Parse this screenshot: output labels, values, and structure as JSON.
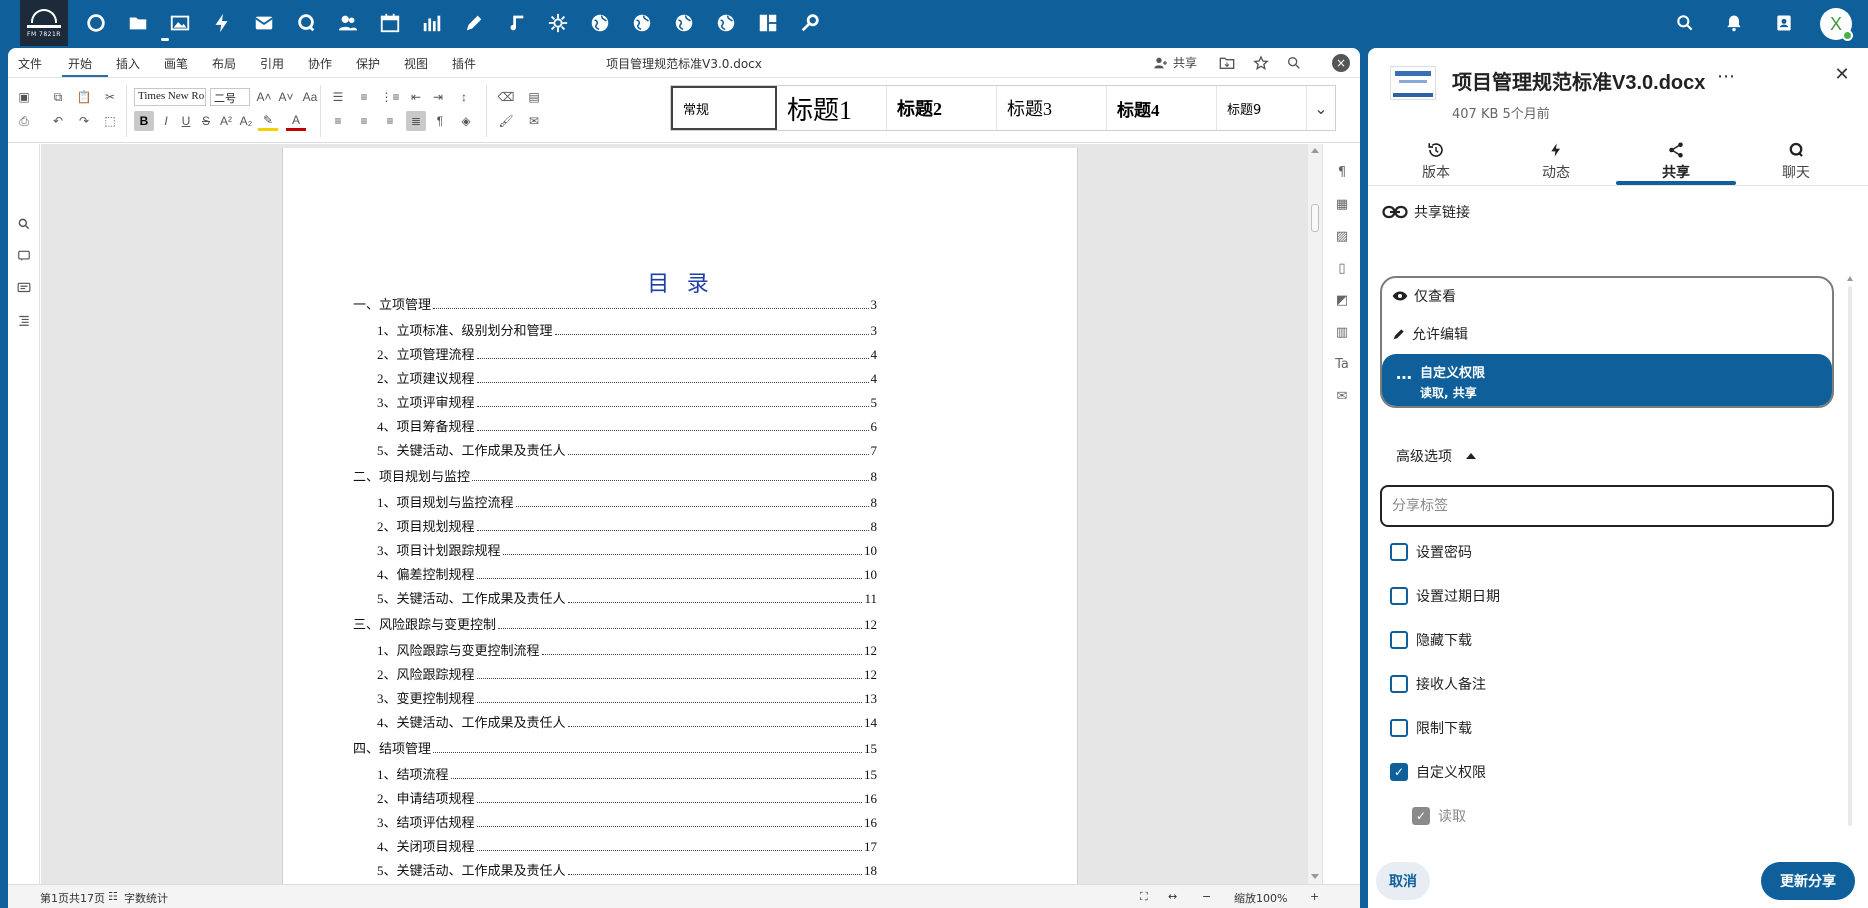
{
  "app": {
    "logo_text": "FM 7821R"
  },
  "nav": {
    "icons": [
      "dashboard-icon",
      "files-icon",
      "photos-icon",
      "activity-icon",
      "mail-icon",
      "talk-icon",
      "contacts-icon",
      "calendar-icon",
      "analytics-icon",
      "notes-icon",
      "music-icon",
      "settings-icon",
      "globe-icon",
      "globe-icon",
      "globe-icon",
      "globe-icon",
      "office-icon",
      "tools-icon"
    ],
    "avatar_letter": "X"
  },
  "editor": {
    "menu_tabs": [
      "文件",
      "开始",
      "插入",
      "画笔",
      "布局",
      "引用",
      "协作",
      "保护",
      "视图",
      "插件"
    ],
    "active_tab": "开始",
    "doc_title": "项目管理规范标准V3.0.docx",
    "share_label": "共享",
    "font_name": "Times New Ro",
    "font_size": "二号",
    "styles": [
      "常规",
      "标题1",
      "标题2",
      "标题3",
      "标题4",
      "标题9"
    ],
    "status": {
      "page_info": "第1页共17页",
      "word_count": "字数统计",
      "zoom": "缩放100%"
    }
  },
  "document": {
    "toc_heading": "目 录",
    "toc": [
      {
        "label": "一、立项管理",
        "page": "3",
        "level": 1
      },
      {
        "label": "1、立项标准、级别划分和管理",
        "page": "3",
        "level": 2
      },
      {
        "label": "2、立项管理流程",
        "page": "4",
        "level": 2
      },
      {
        "label": "2、立项建议规程",
        "page": "4",
        "level": 2
      },
      {
        "label": "3、立项评审规程",
        "page": "5",
        "level": 2
      },
      {
        "label": "4、项目筹备规程",
        "page": "6",
        "level": 2
      },
      {
        "label": "5、关键活动、工作成果及责任人",
        "page": "7",
        "level": 2
      },
      {
        "label": "二、项目规划与监控",
        "page": "8",
        "level": 1
      },
      {
        "label": "1、项目规划与监控流程",
        "page": "8",
        "level": 2
      },
      {
        "label": "2、项目规划规程",
        "page": "8",
        "level": 2
      },
      {
        "label": "3、项目计划跟踪规程",
        "page": "10",
        "level": 2
      },
      {
        "label": "4、偏差控制规程",
        "page": "10",
        "level": 2
      },
      {
        "label": "5、关键活动、工作成果及责任人",
        "page": "11",
        "level": 2
      },
      {
        "label": "三、风险跟踪与变更控制",
        "page": "12",
        "level": 1
      },
      {
        "label": "1、风险跟踪与变更控制流程",
        "page": "12",
        "level": 2
      },
      {
        "label": "2、风险跟踪规程",
        "page": "12",
        "level": 2
      },
      {
        "label": "3、变更控制规程",
        "page": "13",
        "level": 2
      },
      {
        "label": "4、关键活动、工作成果及责任人",
        "page": "14",
        "level": 2
      },
      {
        "label": "四、结项管理",
        "page": "15",
        "level": 1
      },
      {
        "label": "1、结项流程",
        "page": "15",
        "level": 2
      },
      {
        "label": "2、申请结项规程",
        "page": "16",
        "level": 2
      },
      {
        "label": "3、结项评估规程",
        "page": "16",
        "level": 2
      },
      {
        "label": "4、关闭项目规程",
        "page": "17",
        "level": 2
      },
      {
        "label": "5、关键活动、工作成果及责任人",
        "page": "18",
        "level": 2
      }
    ]
  },
  "sidebar": {
    "file_name": "项目管理规范标准V3.0.docx",
    "file_meta": "407 KB 5个月前",
    "tabs": [
      {
        "label": "版本",
        "icon": "history-icon"
      },
      {
        "label": "动态",
        "icon": "activity-icon"
      },
      {
        "label": "共享",
        "icon": "share-icon"
      },
      {
        "label": "聊天",
        "icon": "chat-icon"
      }
    ],
    "active_tab": "共享",
    "share_link_label": "共享链接",
    "permissions": {
      "view_only": "仅查看",
      "allow_edit": "允许编辑",
      "custom": "自定义权限",
      "custom_detail": "读取, 共享"
    },
    "advanced_label": "高级选项",
    "tag_placeholder": "分享标签",
    "options": [
      {
        "label": "设置密码",
        "checked": false
      },
      {
        "label": "设置过期日期",
        "checked": false
      },
      {
        "label": "隐藏下载",
        "checked": false
      },
      {
        "label": "接收人备注",
        "checked": false
      },
      {
        "label": "限制下载",
        "checked": false
      },
      {
        "label": "自定义权限",
        "checked": true
      }
    ],
    "sub_option": {
      "label": "读取",
      "checked": true,
      "disabled": true
    },
    "cancel_label": "取消",
    "update_label": "更新分享"
  },
  "colors": {
    "brand": "#0e5f9a",
    "toc_heading": "#1f3fa8"
  }
}
